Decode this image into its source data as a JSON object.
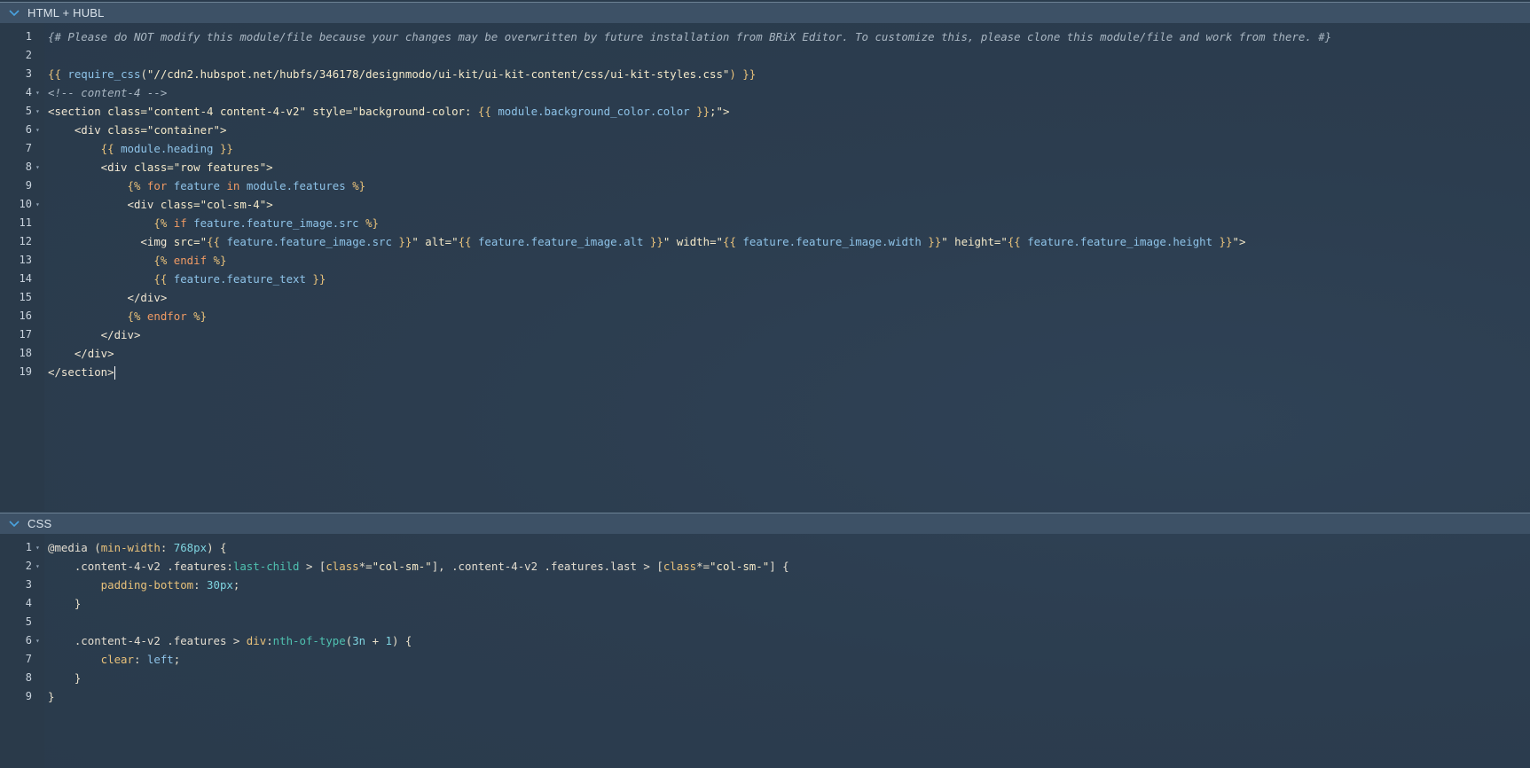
{
  "panels": {
    "html": {
      "title": "HTML + HUBL",
      "lines": [
        {
          "n": "1",
          "fold": false,
          "tokens": [
            {
              "t": "{# Please do NOT modify this module/file because your changes may be overwritten by future installation from BRiX Editor. To customize this, please clone this module/file and work from there. #}",
              "c": "c-cmt"
            }
          ]
        },
        {
          "n": "2",
          "fold": false,
          "tokens": []
        },
        {
          "n": "3",
          "fold": false,
          "tokens": [
            {
              "t": "{{ ",
              "c": "c-hubl"
            },
            {
              "t": "require_css",
              "c": "c-var"
            },
            {
              "t": "(",
              "c": "c-plain"
            },
            {
              "t": "\"//cdn2.hubspot.net/hubfs/346178/designmodo/ui-kit/ui-kit-content/css/ui-kit-styles.css\"",
              "c": "c-str"
            },
            {
              "t": ") }}",
              "c": "c-hubl"
            }
          ]
        },
        {
          "n": "4",
          "fold": true,
          "tokens": [
            {
              "t": "<!-- content-4 -->",
              "c": "c-cmt"
            }
          ]
        },
        {
          "n": "5",
          "fold": true,
          "tokens": [
            {
              "t": "<section ",
              "c": "c-tag"
            },
            {
              "t": "class=",
              "c": "c-attr"
            },
            {
              "t": "\"content-4 content-4-v2\" ",
              "c": "c-str"
            },
            {
              "t": "style=",
              "c": "c-attr"
            },
            {
              "t": "\"background-color: ",
              "c": "c-str"
            },
            {
              "t": "{{ ",
              "c": "c-hubl"
            },
            {
              "t": "module.background_color.color",
              "c": "c-var"
            },
            {
              "t": " }}",
              "c": "c-hubl"
            },
            {
              "t": ";\">",
              "c": "c-str"
            }
          ]
        },
        {
          "n": "6",
          "fold": true,
          "tokens": [
            {
              "t": "    <div ",
              "c": "c-tag"
            },
            {
              "t": "class=",
              "c": "c-attr"
            },
            {
              "t": "\"container\">",
              "c": "c-str"
            }
          ]
        },
        {
          "n": "7",
          "fold": false,
          "tokens": [
            {
              "t": "        {{ ",
              "c": "c-hubl"
            },
            {
              "t": "module.heading",
              "c": "c-var"
            },
            {
              "t": " }}",
              "c": "c-hubl"
            }
          ]
        },
        {
          "n": "8",
          "fold": true,
          "tokens": [
            {
              "t": "        <div ",
              "c": "c-tag"
            },
            {
              "t": "class=",
              "c": "c-attr"
            },
            {
              "t": "\"row features\">",
              "c": "c-str"
            }
          ]
        },
        {
          "n": "9",
          "fold": false,
          "tokens": [
            {
              "t": "            {% ",
              "c": "c-hubl"
            },
            {
              "t": "for ",
              "c": "c-kw"
            },
            {
              "t": "feature ",
              "c": "c-var"
            },
            {
              "t": "in ",
              "c": "c-kw"
            },
            {
              "t": "module.features",
              "c": "c-var"
            },
            {
              "t": " %}",
              "c": "c-hubl"
            }
          ]
        },
        {
          "n": "10",
          "fold": true,
          "tokens": [
            {
              "t": "            <div ",
              "c": "c-tag"
            },
            {
              "t": "class=",
              "c": "c-attr"
            },
            {
              "t": "\"col-sm-4\">",
              "c": "c-str"
            }
          ]
        },
        {
          "n": "11",
          "fold": false,
          "tokens": [
            {
              "t": "                {% ",
              "c": "c-hubl"
            },
            {
              "t": "if ",
              "c": "c-kw"
            },
            {
              "t": "feature.feature_image.src",
              "c": "c-var"
            },
            {
              "t": " %}",
              "c": "c-hubl"
            }
          ]
        },
        {
          "n": "12",
          "fold": false,
          "tokens": [
            {
              "t": "              <img ",
              "c": "c-tag"
            },
            {
              "t": "src=",
              "c": "c-attr"
            },
            {
              "t": "\"",
              "c": "c-str"
            },
            {
              "t": "{{ ",
              "c": "c-hubl"
            },
            {
              "t": "feature.feature_image.src",
              "c": "c-var"
            },
            {
              "t": " }}",
              "c": "c-hubl"
            },
            {
              "t": "\" ",
              "c": "c-str"
            },
            {
              "t": "alt=",
              "c": "c-attr"
            },
            {
              "t": "\"",
              "c": "c-str"
            },
            {
              "t": "{{ ",
              "c": "c-hubl"
            },
            {
              "t": "feature.feature_image.alt",
              "c": "c-var"
            },
            {
              "t": " }}",
              "c": "c-hubl"
            },
            {
              "t": "\" ",
              "c": "c-str"
            },
            {
              "t": "width=",
              "c": "c-attr"
            },
            {
              "t": "\"",
              "c": "c-str"
            },
            {
              "t": "{{ ",
              "c": "c-hubl"
            },
            {
              "t": "feature.feature_image.width",
              "c": "c-var"
            },
            {
              "t": " }}",
              "c": "c-hubl"
            },
            {
              "t": "\" ",
              "c": "c-str"
            },
            {
              "t": "height=",
              "c": "c-attr"
            },
            {
              "t": "\"",
              "c": "c-str"
            },
            {
              "t": "{{ ",
              "c": "c-hubl"
            },
            {
              "t": "feature.feature_image.height",
              "c": "c-var"
            },
            {
              "t": " }}",
              "c": "c-hubl"
            },
            {
              "t": "\">",
              "c": "c-str"
            }
          ]
        },
        {
          "n": "13",
          "fold": false,
          "tokens": [
            {
              "t": "                {% ",
              "c": "c-hubl"
            },
            {
              "t": "endif",
              "c": "c-kw"
            },
            {
              "t": " %}",
              "c": "c-hubl"
            }
          ]
        },
        {
          "n": "14",
          "fold": false,
          "tokens": [
            {
              "t": "                {{ ",
              "c": "c-hubl"
            },
            {
              "t": "feature.feature_text",
              "c": "c-var"
            },
            {
              "t": " }}",
              "c": "c-hubl"
            }
          ]
        },
        {
          "n": "15",
          "fold": false,
          "tokens": [
            {
              "t": "            </div>",
              "c": "c-tag"
            }
          ]
        },
        {
          "n": "16",
          "fold": false,
          "tokens": [
            {
              "t": "            {% ",
              "c": "c-hubl"
            },
            {
              "t": "endfor",
              "c": "c-kw"
            },
            {
              "t": " %}",
              "c": "c-hubl"
            }
          ]
        },
        {
          "n": "17",
          "fold": false,
          "tokens": [
            {
              "t": "        </div>",
              "c": "c-tag"
            }
          ]
        },
        {
          "n": "18",
          "fold": false,
          "tokens": [
            {
              "t": "    </div>",
              "c": "c-tag"
            }
          ]
        },
        {
          "n": "19",
          "fold": false,
          "cursor": true,
          "tokens": [
            {
              "t": "</section>",
              "c": "c-tag"
            }
          ]
        }
      ]
    },
    "css": {
      "title": "CSS",
      "lines": [
        {
          "n": "1",
          "fold": true,
          "tokens": [
            {
              "t": "@media ",
              "c": "c-sel"
            },
            {
              "t": "(",
              "c": "c-plain"
            },
            {
              "t": "min-width",
              "c": "c-prop"
            },
            {
              "t": ": ",
              "c": "c-plain"
            },
            {
              "t": "768px",
              "c": "c-num"
            },
            {
              "t": ") {",
              "c": "c-plain"
            }
          ]
        },
        {
          "n": "2",
          "fold": true,
          "tokens": [
            {
              "t": "    .content-4-v2 .features",
              "c": "c-sel"
            },
            {
              "t": ":",
              "c": "c-plain"
            },
            {
              "t": "last-child",
              "c": "c-pseudo"
            },
            {
              "t": " > [",
              "c": "c-sel"
            },
            {
              "t": "class",
              "c": "c-prop"
            },
            {
              "t": "*=",
              "c": "c-plain"
            },
            {
              "t": "\"col-sm-\"",
              "c": "c-str"
            },
            {
              "t": "], .content-4-v2 .features.last > [",
              "c": "c-sel"
            },
            {
              "t": "class",
              "c": "c-prop"
            },
            {
              "t": "*=",
              "c": "c-plain"
            },
            {
              "t": "\"col-sm-\"",
              "c": "c-str"
            },
            {
              "t": "] {",
              "c": "c-sel"
            }
          ]
        },
        {
          "n": "3",
          "fold": false,
          "tokens": [
            {
              "t": "        padding-bottom",
              "c": "c-prop"
            },
            {
              "t": ": ",
              "c": "c-plain"
            },
            {
              "t": "30px",
              "c": "c-num"
            },
            {
              "t": ";",
              "c": "c-plain"
            }
          ]
        },
        {
          "n": "4",
          "fold": false,
          "tokens": [
            {
              "t": "    }",
              "c": "c-plain"
            }
          ]
        },
        {
          "n": "5",
          "fold": false,
          "tokens": []
        },
        {
          "n": "6",
          "fold": true,
          "tokens": [
            {
              "t": "    .content-4-v2 .features > ",
              "c": "c-sel"
            },
            {
              "t": "div",
              "c": "c-prop"
            },
            {
              "t": ":",
              "c": "c-plain"
            },
            {
              "t": "nth-of-type",
              "c": "c-pseudo"
            },
            {
              "t": "(",
              "c": "c-plain"
            },
            {
              "t": "3n",
              "c": "c-num"
            },
            {
              "t": " + ",
              "c": "c-plain"
            },
            {
              "t": "1",
              "c": "c-num"
            },
            {
              "t": ") {",
              "c": "c-plain"
            }
          ]
        },
        {
          "n": "7",
          "fold": false,
          "tokens": [
            {
              "t": "        clear",
              "c": "c-prop"
            },
            {
              "t": ": ",
              "c": "c-plain"
            },
            {
              "t": "left",
              "c": "c-var"
            },
            {
              "t": ";",
              "c": "c-plain"
            }
          ]
        },
        {
          "n": "8",
          "fold": false,
          "tokens": [
            {
              "t": "    }",
              "c": "c-plain"
            }
          ]
        },
        {
          "n": "9",
          "fold": false,
          "tokens": [
            {
              "t": "}",
              "c": "c-plain"
            }
          ]
        }
      ]
    }
  },
  "icons": {
    "collapse": "chevron-down-icon",
    "fold": "fold-triangle-icon"
  },
  "colors": {
    "header_bg": "#3d5166",
    "editor_bg": "#2d3e50",
    "chevron": "#4aa3df"
  }
}
